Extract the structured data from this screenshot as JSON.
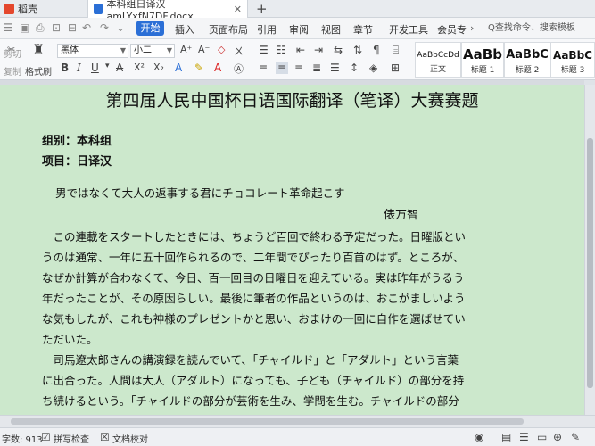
{
  "tabs": [
    {
      "label": "稻壳"
    },
    {
      "label": "本科组日译汉amLYxfN7DF.docx",
      "close": "✕"
    }
  ],
  "new_tab": "+",
  "menu": {
    "start": "开始",
    "items": [
      "插入",
      "页面布局",
      "引用",
      "审阅",
      "视图",
      "章节",
      "开发工具",
      "会员专"
    ],
    "more": "›",
    "search_placeholder": "Q查找命令、搜索模板"
  },
  "ribbon": {
    "cut": "剪切",
    "copy": "复制",
    "format_painter": "格式刷",
    "font_name": "黑体",
    "font_size": "小二",
    "styles": [
      {
        "preview": "AaBbCcDd",
        "name": "正文"
      },
      {
        "preview": "AaBb",
        "name": "标题 1"
      },
      {
        "preview": "AaBbC",
        "name": "标题 2"
      },
      {
        "preview": "AaBbC",
        "name": "标题 3"
      }
    ]
  },
  "document": {
    "title": "第四届人民中国杯日语国际翻译（笔译）大赛赛题",
    "group": "组别：本科组",
    "item": "项目：日译汉",
    "subtitle": "男ではなくて大人の返事する君にチョコレート革命起こす",
    "author": "俵万智",
    "lines": [
      "　この連載をスタートしたときには、ちょうど百回で終わる予定だった。日曜版とい",
      "うのは通常、一年に五十回作られるので、二年間でぴったり百首のはず。ところが、",
      "なぜか計算が合わなくて、今日、百一回目の日曜日を迎えている。実は昨年がうるう",
      "年だったことが、その原因らしい。最後に筆者の作品というのは、おこがましいよう",
      "な気もしたが、これも神様のプレゼントかと思い、おまけの一回に自作を選ばせてい",
      "ただいた。",
      "　司馬遼太郎さんの講演録を読んでいて、「チャイルド」と「アダルト」という言葉",
      "に出合った。人間は大人（アダルト）になっても、子ども（チャイルド）の部分を持",
      "ち続けるという。「チャイルドの部分が芸術を生み、学問を生む。チャイルドの部分"
    ]
  },
  "status": {
    "word_count": "字数: 913",
    "spell_check": "拼写检查",
    "proofread": "文档校对"
  }
}
